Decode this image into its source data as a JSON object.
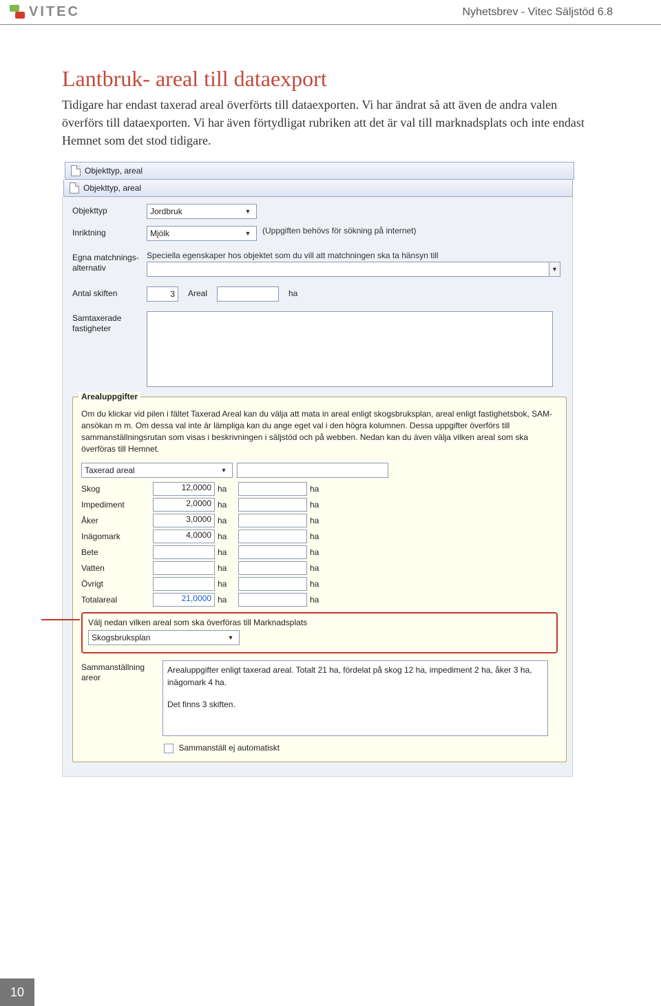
{
  "header": {
    "brand": "VITEC",
    "right": "Nyhetsbrev - Vitec Säljstöd 6.8"
  },
  "h1": "Lantbruk- areal till dataexport",
  "para": "Tidigare har endast taxerad areal överförts till dataexporten. Vi har ändrat så att även de andra valen överförs till dataexporten. Vi har även förtydligat rubriken att det är val till marknadsplats och inte endast Hemnet som det stod tidigare.",
  "shot": {
    "bar1": "Objekttyp, areal",
    "bar2": "Objekttyp, areal",
    "fields": {
      "objekttyp": {
        "label": "Objekttyp",
        "value": "Jordbruk"
      },
      "inriktning": {
        "label": "Inriktning",
        "value": "Mjölk",
        "hint": "(Uppgiften behövs för sökning på internet)"
      },
      "egna": {
        "label": "Egna matchnings-alternativ",
        "hint": "Speciella egenskaper hos objektet som du vill att matchningen ska ta hänsyn till"
      },
      "antal_skiften": {
        "label": "Antal skiften",
        "value": "3",
        "areal_label": "Areal",
        "unit": "ha"
      },
      "samtax": {
        "label": "Samtaxerade fastigheter"
      }
    },
    "group": {
      "title": "Arealuppgifter",
      "info": "Om du klickar vid pilen i fältet Taxerad Areal kan du välja att mata in areal enligt skogsbruksplan, areal enligt fastighetsbok, SAM-ansökan m m. Om dessa val inte är lämpliga kan du ange eget val i den högra kolumnen. Dessa uppgifter överförs till sammanställningsrutan som visas i beskrivningen i säljstöd och på webben. Nedan kan du även välja vilken areal som ska överföras till Hemnet.",
      "taxerad": "Taxerad areal",
      "rows": [
        {
          "label": "Skog",
          "value": "12,0000",
          "unit": "ha",
          "unit2": "ha"
        },
        {
          "label": "Impediment",
          "value": "2,0000",
          "unit": "ha",
          "unit2": "ha"
        },
        {
          "label": "Åker",
          "value": "3,0000",
          "unit": "ha",
          "unit2": "ha"
        },
        {
          "label": "Inägomark",
          "value": "4,0000",
          "unit": "ha",
          "unit2": "ha"
        },
        {
          "label": "Bete",
          "value": "",
          "unit": "ha",
          "unit2": "ha"
        },
        {
          "label": "Vatten",
          "value": "",
          "unit": "ha",
          "unit2": "ha"
        },
        {
          "label": "Övrigt",
          "value": "",
          "unit": "ha",
          "unit2": "ha"
        },
        {
          "label": "Totalareal",
          "value": "21,0000",
          "unit": "ha",
          "unit2": "ha",
          "total": true
        }
      ],
      "red_label": "Välj nedan vilken areal som ska överföras till Marknadsplats",
      "red_value": "Skogsbruksplan",
      "sum_label": "Sammanställning areor",
      "sum_text1": "Arealuppgifter enligt taxerad areal. Totalt 21 ha, fördelat på skog 12 ha, impediment 2 ha, åker 3 ha, inägomark 4 ha.",
      "sum_text2": "Det finns 3 skiften.",
      "cb_label": "Sammanställ ej automatiskt"
    }
  },
  "pagenum": "10"
}
